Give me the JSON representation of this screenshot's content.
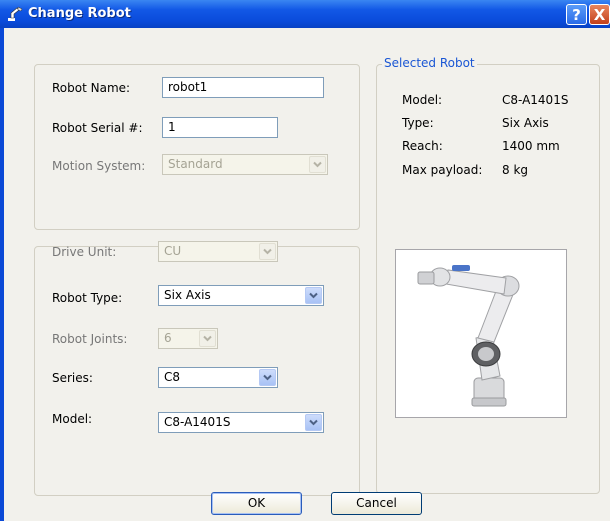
{
  "window": {
    "title": "Change Robot",
    "help_icon": "?",
    "close_icon": "X"
  },
  "form": {
    "robot_name": {
      "label": "Robot Name:",
      "value": "robot1"
    },
    "robot_serial": {
      "label": "Robot Serial #:",
      "value": "1"
    },
    "motion_system": {
      "label": "Motion System:",
      "value": "Standard"
    },
    "drive_unit": {
      "label": "Drive Unit:",
      "value": "CU"
    },
    "robot_type": {
      "label": "Robot Type:",
      "value": "Six Axis"
    },
    "robot_joints": {
      "label": "Robot Joints:",
      "value": "6"
    },
    "series": {
      "label": "Series:",
      "value": "C8"
    },
    "model": {
      "label": "Model:",
      "value": "C8-A1401S"
    }
  },
  "selected_robot": {
    "title": "Selected Robot",
    "rows": [
      {
        "label": "Model:",
        "value": "C8-A1401S"
      },
      {
        "label": "Type:",
        "value": "Six Axis"
      },
      {
        "label": "Reach:",
        "value": "1400 mm"
      },
      {
        "label": "Max payload:",
        "value": "8 kg"
      }
    ]
  },
  "buttons": {
    "ok": "OK",
    "cancel": "Cancel"
  }
}
